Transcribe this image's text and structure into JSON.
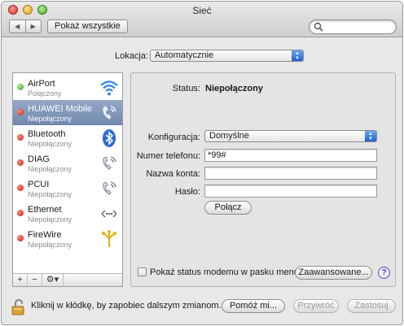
{
  "window": {
    "title": "Sieć"
  },
  "toolbar": {
    "back_glyph": "◀",
    "forward_glyph": "▶",
    "show_all_label": "Pokaż wszystkie",
    "search_placeholder": "",
    "search_icon": "magnifier-icon"
  },
  "location": {
    "label": "Lokacja:",
    "value": "Automatycznie"
  },
  "services": [
    {
      "name": "AirPort",
      "status": "Połączony",
      "status_color": "green",
      "icon": "wifi-icon"
    },
    {
      "name": "HUAWEI Mobile",
      "status": "Niepołączony",
      "status_color": "red",
      "icon": "phone-icon",
      "selected": true
    },
    {
      "name": "Bluetooth",
      "status": "Niepołączony",
      "status_color": "red",
      "icon": "bluetooth-icon"
    },
    {
      "name": "DIAG",
      "status": "Niepołączony",
      "status_color": "red",
      "icon": "phone-icon"
    },
    {
      "name": "PCUI",
      "status": "Niepołączony",
      "status_color": "red",
      "icon": "phone-icon"
    },
    {
      "name": "Ethernet",
      "status": "Niepołączony",
      "status_color": "red",
      "icon": "ethernet-icon"
    },
    {
      "name": "FireWire",
      "status": "Niepołączony",
      "status_color": "red",
      "icon": "firewire-icon"
    }
  ],
  "sidebar_controls": {
    "add": "+",
    "remove": "−",
    "action": "⚙▾"
  },
  "detail": {
    "status_label": "Status:",
    "status_value": "Niepołączony",
    "config_label": "Konfiguracja:",
    "config_value": "Domyślne",
    "phone_label": "Numer telefonu:",
    "phone_value": "*99#",
    "account_label": "Nazwa konta:",
    "account_value": "",
    "password_label": "Hasło:",
    "password_value": "",
    "connect_button": "Połącz",
    "modem_status_checkbox_label": "Pokaż status modemu w pasku menu",
    "modem_status_checked": false,
    "advanced_button": "Zaawansowane...",
    "help_glyph": "?"
  },
  "bottom": {
    "lock_text": "Kliknij w kłódkę, by zapobiec dalszym zmianom.",
    "assist_button": "Pomóż mi...",
    "revert_button": "Przywróć",
    "apply_button": "Zastosuj"
  },
  "colors": {
    "selection": "#7f95b8",
    "status_green": "#3e9d1f",
    "status_red": "#c71e12",
    "accent_blue": "#1e62d0"
  }
}
